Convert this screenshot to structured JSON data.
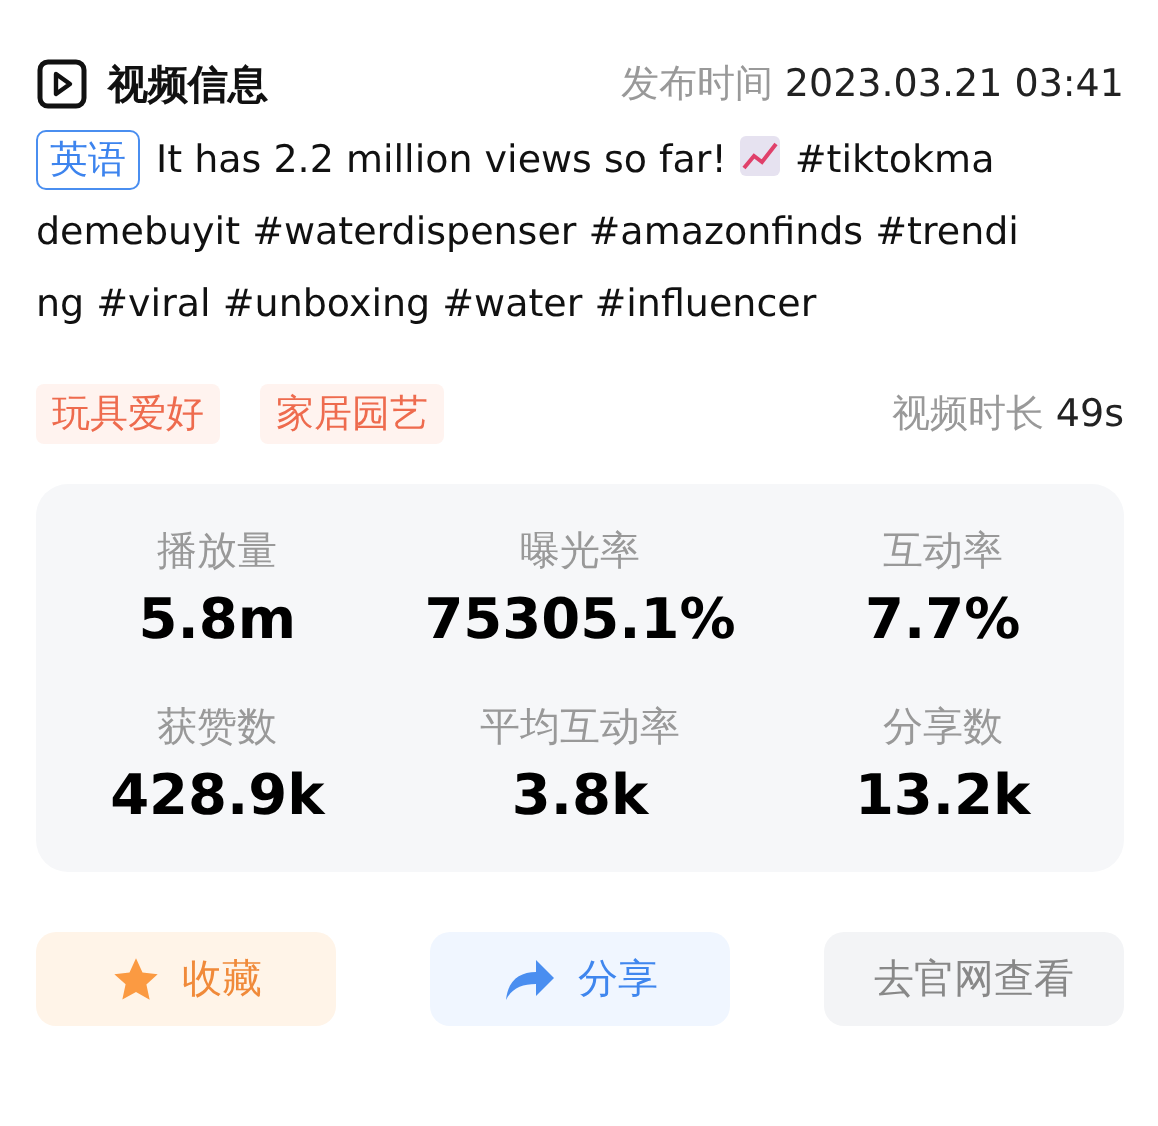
{
  "header": {
    "title": "视频信息",
    "publish_label": "发布时间",
    "publish_time": "2023.03.21 03:41"
  },
  "description": {
    "language": "英语",
    "text_before": "It has 2.2 million views so far!",
    "lines_after": [
      "#tiktokma",
      "demebuyit #waterdispenser #amazonfinds #trendi",
      "ng #viral #unboxing #water #influencer"
    ]
  },
  "categories": [
    "玩具爱好",
    "家居园艺"
  ],
  "duration": {
    "label": "视频时长",
    "value": "49s"
  },
  "stats": [
    {
      "label": "播放量",
      "value": "5.8m"
    },
    {
      "label": "曝光率",
      "value": "75305.1%"
    },
    {
      "label": "互动率",
      "value": "7.7%"
    },
    {
      "label": "获赞数",
      "value": "428.9k"
    },
    {
      "label": "平均互动率",
      "value": "3.8k"
    },
    {
      "label": "分享数",
      "value": "13.2k"
    }
  ],
  "buttons": [
    {
      "kind": "favorite",
      "label": "收藏"
    },
    {
      "kind": "share",
      "label": "分享"
    },
    {
      "kind": "website",
      "label": "去官网查看"
    }
  ]
}
